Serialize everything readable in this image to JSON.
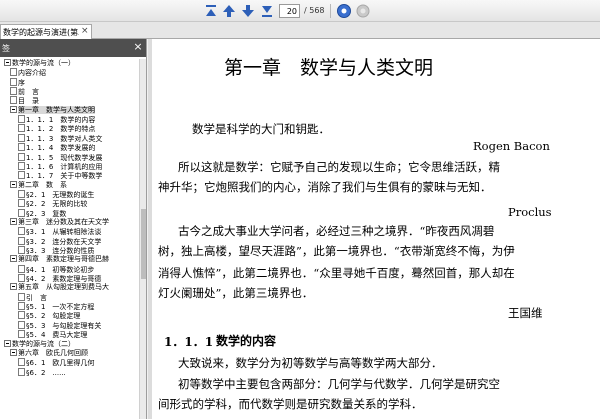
{
  "toolbar": {
    "page_current": "20",
    "page_total": "/ 568",
    "icons": [
      "first-page-icon",
      "prev-page-icon",
      "next-page-icon",
      "last-page-icon",
      "goto-page-icon",
      "stop-icon"
    ]
  },
  "tab": {
    "title": "数学的起源与演进(第二版)-张顺燕.扫...",
    "close": "×"
  },
  "sidebar": {
    "title": "签",
    "close": "×",
    "items": [
      {
        "label": "数学的源与流（一）",
        "level": 0,
        "toggle": "ex"
      },
      {
        "label": "内容介绍",
        "level": 1,
        "toggle": "page"
      },
      {
        "label": "序",
        "level": 1,
        "toggle": "page"
      },
      {
        "label": "前　言",
        "level": 1,
        "toggle": "page"
      },
      {
        "label": "目　录",
        "level": 1,
        "toggle": "page"
      },
      {
        "label": "第一章　数学与人类文明",
        "level": 1,
        "toggle": "ex",
        "selected": true
      },
      {
        "label": "1．1．1　数学的内容",
        "level": 2,
        "toggle": "page"
      },
      {
        "label": "1．1．2　数学的特点",
        "level": 2,
        "toggle": "page"
      },
      {
        "label": "1．1．3　数学对人类文",
        "level": 2,
        "toggle": "page"
      },
      {
        "label": "1．1．4　数学发展的",
        "level": 2,
        "toggle": "page"
      },
      {
        "label": "1．1．5　现代数学发展",
        "level": 2,
        "toggle": "page"
      },
      {
        "label": "1．1．6　计算机的应用",
        "level": 2,
        "toggle": "page"
      },
      {
        "label": "1．1．7　关于中等数学",
        "level": 2,
        "toggle": "page"
      },
      {
        "label": "第二章　数　系",
        "level": 1,
        "toggle": "ex"
      },
      {
        "label": "§2．1　无理数的诞生",
        "level": 2,
        "toggle": "page"
      },
      {
        "label": "§2．2　无限的比较",
        "level": 2,
        "toggle": "page"
      },
      {
        "label": "§2．3　复数",
        "level": 2,
        "toggle": "page"
      },
      {
        "label": "第三章　迷分数及其在天文学",
        "level": 1,
        "toggle": "ex"
      },
      {
        "label": "§3．1　从辗转相除法谈",
        "level": 2,
        "toggle": "page"
      },
      {
        "label": "§3．2　连分数在天文学",
        "level": 2,
        "toggle": "page"
      },
      {
        "label": "§3．3　连分数的性质",
        "level": 2,
        "toggle": "page"
      },
      {
        "label": "第四章　素数定理与哥德巴赫",
        "level": 1,
        "toggle": "ex"
      },
      {
        "label": "§4．1　初等数论初步",
        "level": 2,
        "toggle": "page"
      },
      {
        "label": "§4．2　素数定理与哥德",
        "level": 2,
        "toggle": "page"
      },
      {
        "label": "第五章　从勾股定理到费马大",
        "level": 1,
        "toggle": "ex"
      },
      {
        "label": "引　言",
        "level": 2,
        "toggle": "page"
      },
      {
        "label": "§5．1　一次不定方程",
        "level": 2,
        "toggle": "page"
      },
      {
        "label": "§5．2　勾股定理",
        "level": 2,
        "toggle": "page"
      },
      {
        "label": "§5．3　与勾股定理有关",
        "level": 2,
        "toggle": "page"
      },
      {
        "label": "§5．4　费马大定理",
        "level": 2,
        "toggle": "page"
      },
      {
        "label": "数学的源与流（二）",
        "level": 0,
        "toggle": "ex"
      },
      {
        "label": "第六章　欧氏几何回顾",
        "level": 1,
        "toggle": "ex"
      },
      {
        "label": "§6．1　欧几里得几何",
        "level": 2,
        "toggle": "page"
      },
      {
        "label": "§6．2　......",
        "level": 2,
        "toggle": "page"
      }
    ]
  },
  "document": {
    "chapter_title": "第一章　数学与人类文明",
    "quote1": "数学是科学的大门和钥匙．",
    "quote1_author": "Rogen Bacon",
    "quote2_line1": "所以这就是数学：它赋予自己的发现以生命；它令思维活跃，精",
    "quote2_line2": "神升华；它炮照我们的内心，消除了我们与生俱有的蒙昧与无知．",
    "quote2_author": "Proclus",
    "quote3_line1": "古今之成大事业大学问者，必经过三种之境界．“昨夜西风凋碧",
    "quote3_line2": "树，独上高楼，望尽天涯路”，此第一境界也．“衣带渐宽终不悔，为伊",
    "quote3_line3": "消得人憔悴”，此第二境界也．“众里寻她千百度，蓦然回首，那人却在",
    "quote3_line4": "灯火阑珊处”，此第三境界也．",
    "quote3_author": "王国维",
    "section_number": "1．1．1",
    "section_title": "数学的内容",
    "para1": "大致说来，数学分为初等数学与高等数学两大部分．",
    "para2_line1": "初等数学中主要包含两部分：几何学与代数学．几何学是研究空",
    "para2_line2": "间形式的学科，而代数学则是研究数量关系的学科．"
  }
}
